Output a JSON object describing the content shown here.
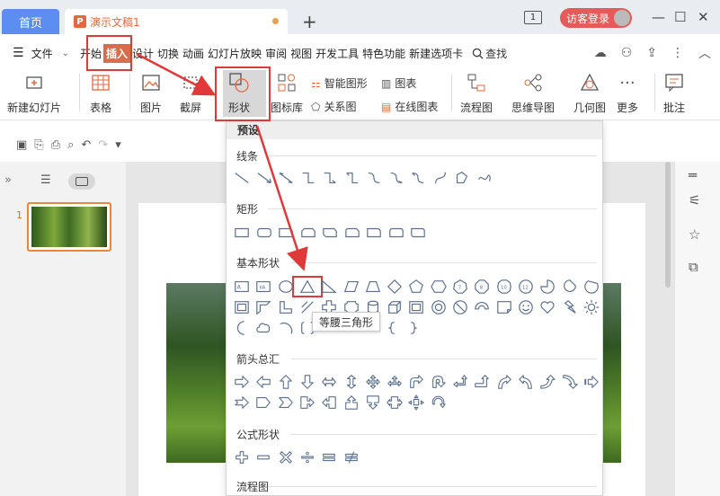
{
  "titlebar": {
    "home_tab": "首页",
    "doc_icon": "P",
    "doc_title": "演示文稿1",
    "new_tab": "+",
    "num_box": "1",
    "login_label": "访客登录",
    "min": "—",
    "max": "☐",
    "close": "✕"
  },
  "menu": {
    "hamburger": "☰",
    "file": "文件",
    "items": [
      "开始",
      "插入",
      "设计",
      "切换",
      "动画",
      "幻灯片放映",
      "审阅",
      "视图",
      "开发工具",
      "特色功能",
      "新建选项卡"
    ],
    "search": "查找"
  },
  "ribbon": {
    "new_slide": "新建幻灯片",
    "table": "表格",
    "picture": "图片",
    "screenshot": "截屏",
    "shape": "形状",
    "icon_lib": "图标库",
    "smart_shape": "智能图形",
    "chart": "图表",
    "relation": "关系图",
    "online_chart": "在线图表",
    "flowchart": "流程图",
    "mindmap": "思维导图",
    "geometry": "几何图",
    "more": "更多",
    "comment": "批注"
  },
  "dropdown": {
    "preset": "预设",
    "lines": "线条",
    "rect": "矩形",
    "basic": "基本形状",
    "arrows": "箭头总汇",
    "formula": "公式形状",
    "flow": "流程图",
    "tooltip": "等腰三角形",
    "oct_labels": [
      "7",
      "8",
      "10",
      "12"
    ]
  },
  "slides": {
    "number": "1"
  },
  "colors": {
    "accent": "#e8663b",
    "annotation": "#e0393a",
    "home_tab": "#5b8ef0"
  }
}
